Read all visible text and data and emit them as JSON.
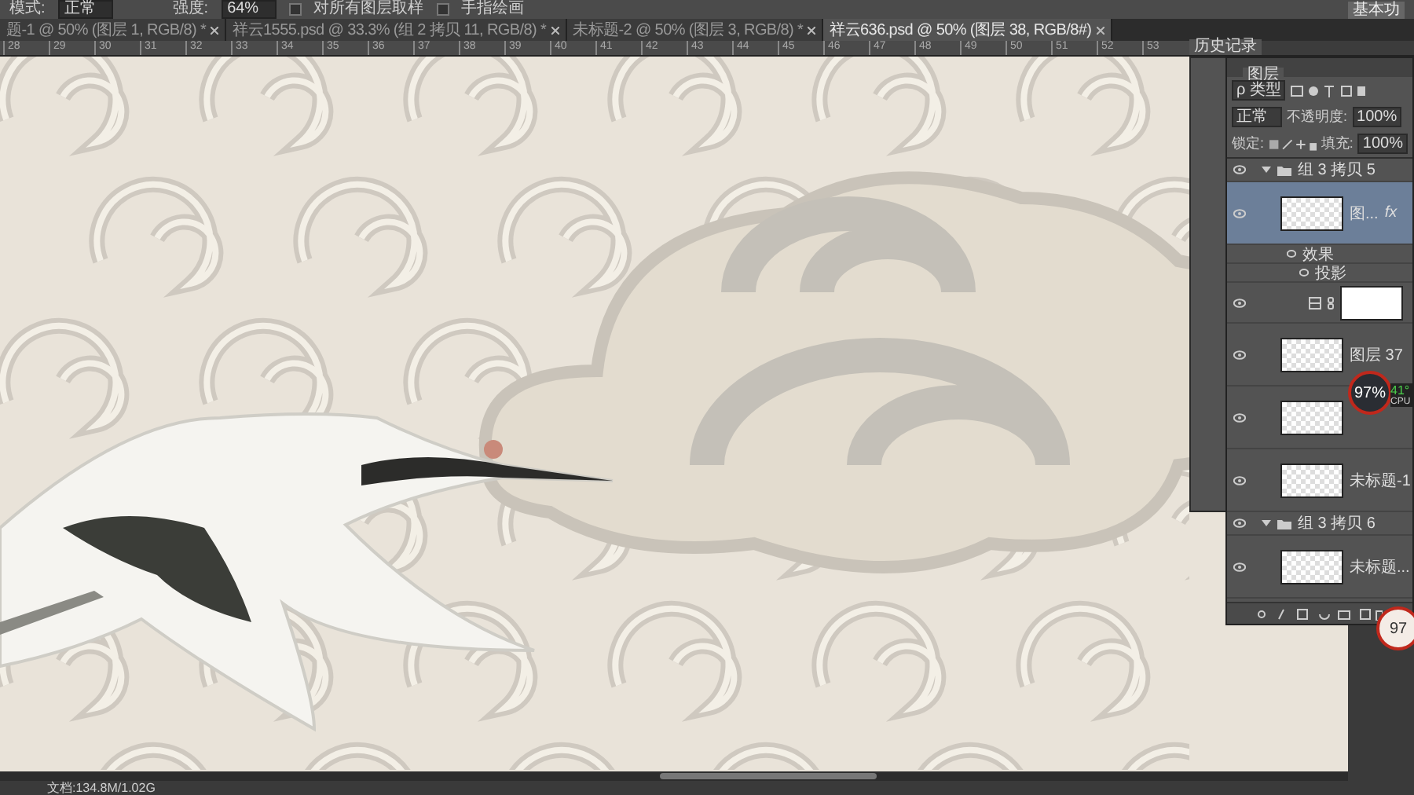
{
  "options_bar": {
    "mode_label": "模式:",
    "mode_value": "正常",
    "strength_label": "强度:",
    "strength_value": "64%",
    "checkboxes": [
      {
        "label": "对所有图层取样",
        "checked": false
      },
      {
        "label": "手指绘画",
        "checked": false
      }
    ],
    "workspace": "基本功"
  },
  "tabs": [
    {
      "label": "题-1 @ 50% (图层 1, RGB/8) *",
      "selected": false
    },
    {
      "label": "祥云1555.psd @ 33.3% (组 2 拷贝 11, RGB/8) *",
      "selected": false
    },
    {
      "label": "未标题-2 @ 50% (图层 3, RGB/8) *",
      "selected": false
    },
    {
      "label": "祥云636.psd @ 50% (图层 38, RGB/8#)",
      "selected": true
    }
  ],
  "ruler": [
    "28",
    "29",
    "30",
    "31",
    "32",
    "33",
    "34",
    "35",
    "36",
    "37",
    "38",
    "39",
    "40",
    "41",
    "42",
    "43",
    "44",
    "45",
    "46",
    "47",
    "48",
    "49",
    "50",
    "51",
    "52",
    "53"
  ],
  "history_panel": {
    "title": "历史记录"
  },
  "layers_panel": {
    "title": "图层",
    "filter": "ρ 类型",
    "blend_mode": "正常",
    "opacity_label": "不透明度:",
    "opacity": "100%",
    "lock_label": "锁定:",
    "fill_label": "填充:",
    "fill": "100%",
    "layers": [
      {
        "kind": "group",
        "name": "组 3 拷贝 5",
        "visible": true,
        "expanded": true,
        "selected": false
      },
      {
        "kind": "layer",
        "name": "图...",
        "visible": true,
        "selected": true,
        "fx": "fx"
      },
      {
        "kind": "effect",
        "name": "效果"
      },
      {
        "kind": "effect",
        "name": "投影"
      },
      {
        "kind": "adjustment",
        "visible": true,
        "selected": false
      },
      {
        "kind": "layer",
        "name": "图层 37",
        "visible": true,
        "selected": false
      },
      {
        "kind": "layer",
        "visible": true,
        "selected": false
      },
      {
        "kind": "layer",
        "name": "未标题-1",
        "visible": true,
        "selected": false
      },
      {
        "kind": "group",
        "name": "组 3 拷贝 6",
        "visible": true,
        "expanded": true,
        "selected": false
      },
      {
        "kind": "layer",
        "name": "未标题...",
        "visible": true,
        "selected": false
      }
    ]
  },
  "monitor": {
    "percent": "97%",
    "temperature": "41°",
    "label": "CPU"
  },
  "monitor_small": {
    "percent": "97"
  },
  "status_bar": {
    "document": "文档:134.8M/1.02G"
  }
}
